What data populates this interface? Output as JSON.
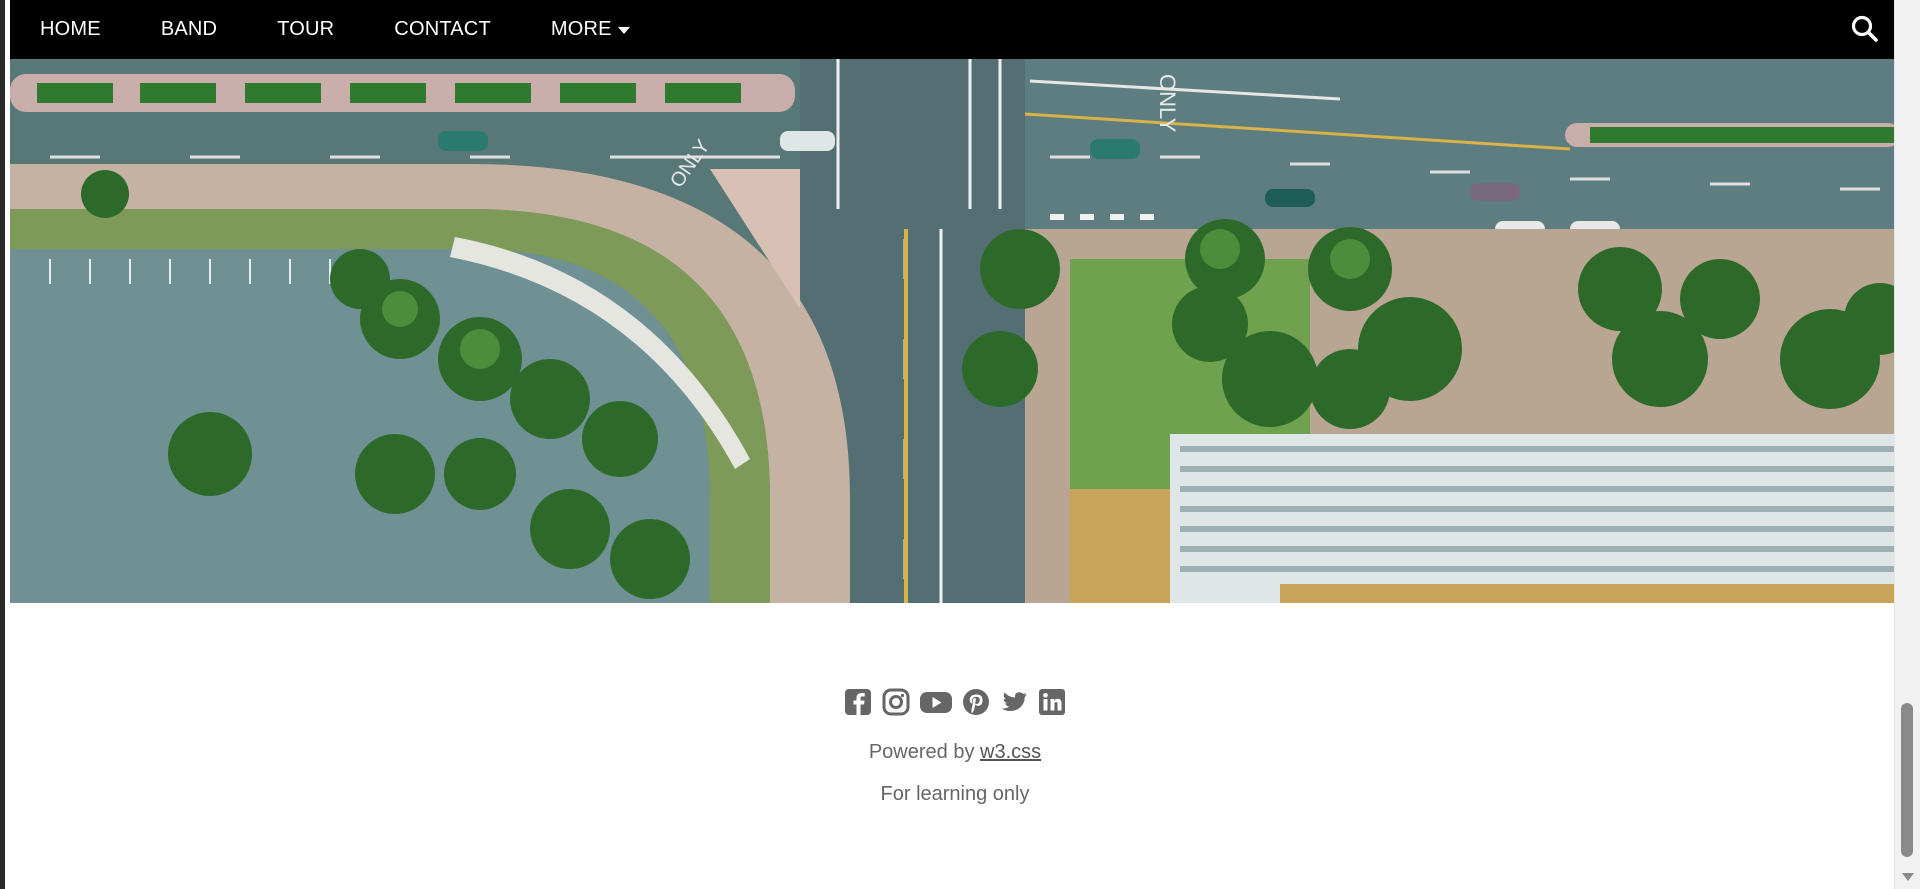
{
  "nav": {
    "items": [
      {
        "label": "HOME"
      },
      {
        "label": "BAND"
      },
      {
        "label": "TOUR"
      },
      {
        "label": "CONTACT"
      },
      {
        "label": "MORE"
      }
    ],
    "search_icon": "search-icon"
  },
  "hero": {
    "image": "aerial-city-intersection",
    "road_text_1": "ONLY",
    "road_text_2": "ONLY"
  },
  "footer": {
    "social_icons": [
      "facebook-icon",
      "instagram-icon",
      "youtube-icon",
      "pinterest-icon",
      "twitter-icon",
      "linkedin-icon"
    ],
    "powered_prefix": "Powered by ",
    "powered_link": "w3.css",
    "note": "For learning only"
  },
  "colors": {
    "nav_bg": "#000000",
    "nav_text": "#ffffff",
    "footer_text": "#757575",
    "road": "#4f6e6e",
    "tree": "#2e6b2a",
    "sidewalk": "#c9b6a6"
  }
}
